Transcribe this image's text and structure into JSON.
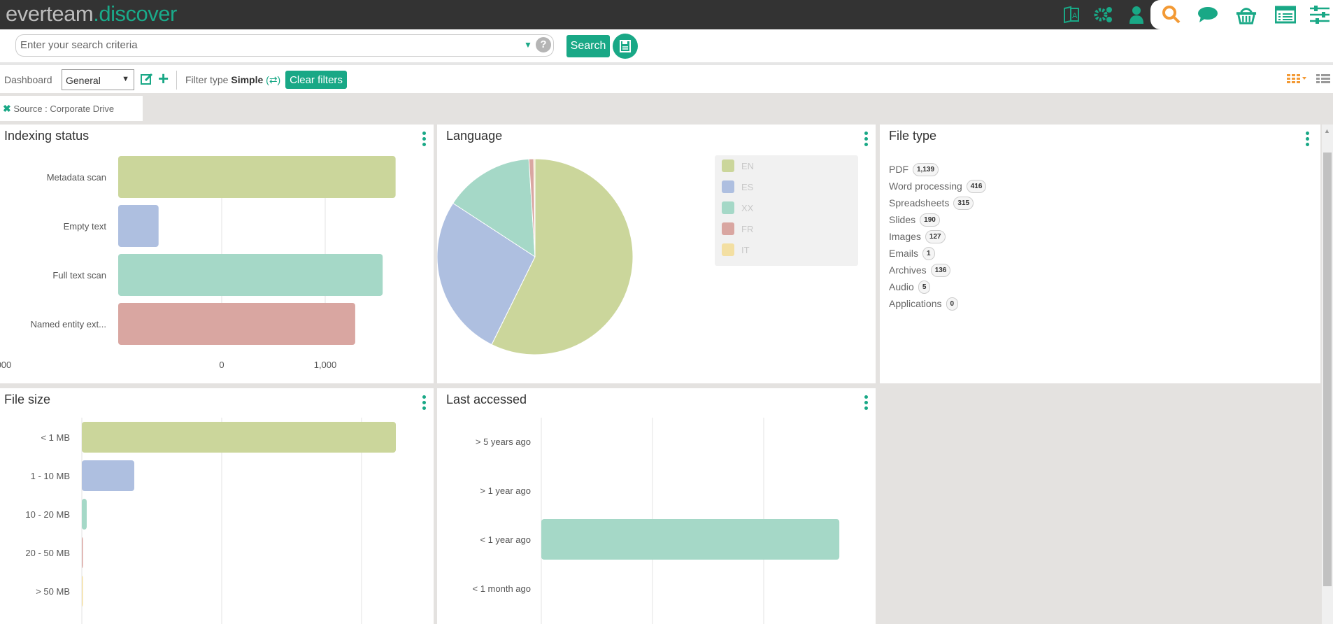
{
  "app": {
    "logo_part1": "everteam",
    "logo_part2": ".discover"
  },
  "topbar": {
    "icons": [
      "translate-icon",
      "gears-icon",
      "user-icon",
      "search-icon",
      "chat-icon",
      "basket-icon",
      "list-window-icon",
      "sliders-icon"
    ],
    "colors": {
      "bar": "#333333",
      "accent": "#19a886",
      "active": "#f39a35"
    }
  },
  "search": {
    "placeholder": "Enter your search criteria",
    "value": "",
    "button_label": "Search"
  },
  "toolbar": {
    "dashboard_label": "Dashboard",
    "dashboard_value": "General",
    "filter_type_label": "Filter type",
    "filter_type_value": "Simple",
    "clear_filters_label": "Clear filters"
  },
  "filters": [
    {
      "label": "Source : Corporate Drive"
    }
  ],
  "panels": {
    "indexing": {
      "title": "Indexing status"
    },
    "language": {
      "title": "Language"
    },
    "filetype": {
      "title": "File type",
      "items": [
        {
          "label": "PDF",
          "count": "1,139"
        },
        {
          "label": "Word processing",
          "count": "416"
        },
        {
          "label": "Spreadsheets",
          "count": "315"
        },
        {
          "label": "Slides",
          "count": "190"
        },
        {
          "label": "Images",
          "count": "127"
        },
        {
          "label": "Emails",
          "count": "1"
        },
        {
          "label": "Archives",
          "count": "136"
        },
        {
          "label": "Audio",
          "count": "5"
        },
        {
          "label": "Applications",
          "count": "0"
        }
      ]
    },
    "filesize": {
      "title": "File size"
    },
    "lastaccessed": {
      "title": "Last accessed"
    }
  },
  "chart_data": [
    {
      "type": "bar",
      "orientation": "horizontal",
      "title": "Indexing status",
      "categories": [
        "Metadata scan",
        "Empty text",
        "Full text scan",
        "Named entity ext..."
      ],
      "values": [
        2680,
        390,
        2555,
        2290
      ],
      "colors": [
        "#cbd69b",
        "#aebfe0",
        "#a5d8c7",
        "#d9a6a1"
      ],
      "xticks": [
        "0",
        "1,000",
        "2,000"
      ],
      "xlim": [
        0,
        2900
      ],
      "grid": true
    },
    {
      "type": "pie",
      "title": "Language",
      "categories": [
        "EN",
        "ES",
        "XX",
        "FR",
        "IT"
      ],
      "values": [
        57.3,
        26.9,
        14.8,
        0.8,
        0.2
      ],
      "colors": [
        "#cbd69b",
        "#aebfe0",
        "#a5d8c7",
        "#d9a6a1",
        "#f3dfa2"
      ],
      "legend": "right"
    },
    {
      "type": "bar",
      "orientation": "horizontal",
      "title": "File size",
      "categories": [
        "< 1 MB",
        "1 - 10 MB",
        "10 - 20 MB",
        "20 - 50 MB",
        "> 50 MB"
      ],
      "values": [
        2245,
        375,
        35,
        4,
        4
      ],
      "colors": [
        "#cbd69b",
        "#aebfe0",
        "#a5d8c7",
        "#d9a6a1",
        "#f3dfa2"
      ],
      "grid": true
    },
    {
      "type": "bar",
      "orientation": "horizontal",
      "title": "Last accessed",
      "categories": [
        "> 5 years ago",
        "> 1 year ago",
        "< 1 year ago",
        "< 1 month ago"
      ],
      "values": [
        0,
        0,
        2680,
        0
      ],
      "colors": [
        "#a5d8c7",
        "#a5d8c7",
        "#a5d8c7",
        "#a5d8c7"
      ],
      "grid": true
    }
  ]
}
